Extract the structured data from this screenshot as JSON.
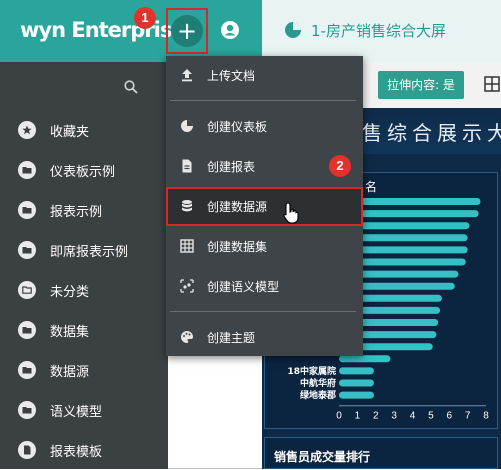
{
  "header": {
    "logo": "wyn Enterprise",
    "plus_label": "+"
  },
  "badges": {
    "first": "1",
    "second": "2"
  },
  "tab": {
    "title": "1-房产销售综合大屏"
  },
  "toolbar": {
    "stretch_label": "拉伸内容: 是"
  },
  "dashboard": {
    "title": "售综合展示大",
    "panel_title_fragment": "名",
    "bottom_panel_title": "销售员成交量排行"
  },
  "sidebar": {
    "items": [
      {
        "label": "收藏夹",
        "icon": "star-icon"
      },
      {
        "label": "仪表板示例",
        "icon": "folder-icon"
      },
      {
        "label": "报表示例",
        "icon": "folder-icon"
      },
      {
        "label": "即席报表示例",
        "icon": "folder-icon"
      },
      {
        "label": "未分类",
        "icon": "folder-outline-icon"
      },
      {
        "label": "数据集",
        "icon": "folder-icon"
      },
      {
        "label": "数据源",
        "icon": "folder-icon"
      },
      {
        "label": "语义模型",
        "icon": "folder-icon"
      },
      {
        "label": "报表模板",
        "icon": "report-template-icon"
      }
    ]
  },
  "menu": {
    "items": [
      {
        "label": "上传文档",
        "icon": "upload-icon"
      },
      {
        "label": "创建仪表板",
        "icon": "pie-icon"
      },
      {
        "label": "创建报表",
        "icon": "document-icon"
      },
      {
        "label": "创建数据源",
        "icon": "database-icon"
      },
      {
        "label": "创建数据集",
        "icon": "grid-icon"
      },
      {
        "label": "创建语义模型",
        "icon": "model-icon"
      },
      {
        "label": "创建主题",
        "icon": "palette-icon"
      }
    ]
  },
  "chart_data": {
    "type": "bar",
    "orientation": "horizontal",
    "title": "",
    "categories": [
      "",
      "",
      "",
      "",
      "",
      "",
      "",
      "",
      "",
      "",
      "",
      "",
      "",
      "",
      "18中家属院",
      "中航华府",
      "绿地泰郡"
    ],
    "values": [
      7.7,
      7.6,
      7.1,
      7.0,
      7.0,
      6.9,
      6.5,
      6.3,
      5.6,
      5.5,
      5.4,
      5.3,
      5.1,
      2.8,
      1.9,
      1.9,
      1.9
    ],
    "xticks": [
      "0",
      "1",
      "2",
      "3",
      "4",
      "5",
      "6",
      "7",
      "8"
    ],
    "xlim": [
      0,
      8
    ],
    "bar_color": "#36c0c4"
  },
  "colors": {
    "accent": "#2aa59b",
    "highlight": "#d92626",
    "sidebar": "#3b4043",
    "menu": "#3f4448"
  }
}
